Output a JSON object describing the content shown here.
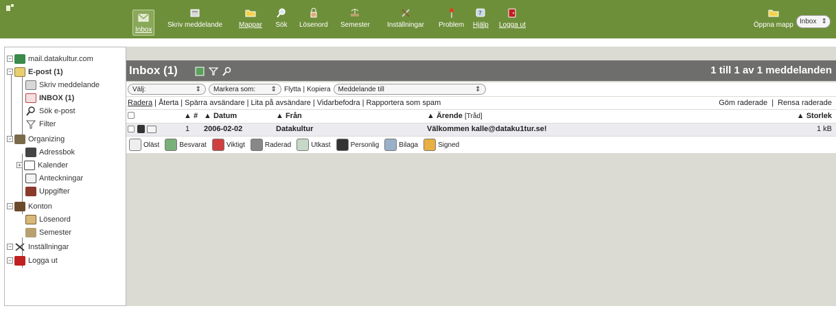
{
  "toolbar": {
    "items": [
      {
        "label": "Inbox",
        "icon": "inbox-icon",
        "color": "#dfe9c9"
      },
      {
        "label": "Skriv meddelande",
        "icon": "compose-icon",
        "color": "#d8d8d8"
      },
      {
        "label": "Mappar",
        "icon": "folder-icon",
        "color": "#f2d14c"
      },
      {
        "label": "Sök",
        "icon": "magnifier-icon",
        "color": "#d8e6f2"
      },
      {
        "label": "Lösenord",
        "icon": "lock-icon",
        "color": "#e0a97a"
      },
      {
        "label": "Semester",
        "icon": "vacation-icon",
        "color": "#b8a070"
      },
      {
        "label": "Inställningar",
        "icon": "tools-icon",
        "color": "#cfcfcf"
      },
      {
        "label": "Problem",
        "icon": "pin-icon",
        "color": "#e04020"
      },
      {
        "label": "Hjälp",
        "icon": "help-icon",
        "color": "#c8d8e8"
      },
      {
        "label": "Logga ut",
        "icon": "logout-icon",
        "color": "#c02020"
      }
    ],
    "open_folder_label": "Öppna mapp",
    "folder_select": "Inbox"
  },
  "sidebar": {
    "items": [
      {
        "label": "mail.datakultur.com",
        "icon": "server-icon"
      },
      {
        "label": "E-post (1)",
        "icon": "email-icon"
      },
      {
        "label": "Skriv meddelande",
        "icon": "compose-icon"
      },
      {
        "label": "INBOX (1)",
        "icon": "inbox-icon"
      },
      {
        "label": "Sök e-post",
        "icon": "search-icon"
      },
      {
        "label": "Filter",
        "icon": "filter-icon"
      },
      {
        "label": "Organizing",
        "icon": "organizing-icon"
      },
      {
        "label": "Adressbok",
        "icon": "addressbook-icon"
      },
      {
        "label": "Kalender",
        "icon": "calendar-icon"
      },
      {
        "label": "Anteckningar",
        "icon": "notes-icon"
      },
      {
        "label": "Uppgifter",
        "icon": "tasks-icon"
      },
      {
        "label": "Konton",
        "icon": "accounts-icon"
      },
      {
        "label": "Lösenord",
        "icon": "lock-icon"
      },
      {
        "label": "Semester",
        "icon": "vacation-icon"
      },
      {
        "label": "Inställningar",
        "icon": "tools-icon"
      },
      {
        "label": "Logga ut",
        "icon": "logout-icon"
      }
    ]
  },
  "main": {
    "title": "Inbox (1)",
    "counts": "1 till 1 av 1 meddelanden",
    "select_label": "Välj:",
    "mark_label": "Markera som:",
    "move_label": "Flytta",
    "copy_label": "Kopiera",
    "message_to_label": "Meddelande till",
    "actions": [
      "Radera",
      "Återta",
      "Spärra avsändare",
      "Lita på avsändare",
      "Vidarbefodra",
      "Rapportera som spam"
    ],
    "actions_right": [
      "Göm raderade",
      "Rensa raderade"
    ],
    "columns": {
      "num": "▲ #",
      "date": "▲ Datum",
      "from": "▲ Från",
      "subject": "▲ Ärende",
      "thread": "[Tråd]",
      "size": "▲ Storlek"
    },
    "messages": [
      {
        "num": "1",
        "date": "2006-02-02",
        "from": "Datakultur",
        "subject": "Välkommen kalle@dataku1tur.se!",
        "size": "1 kB"
      }
    ],
    "legend": [
      "Oläst",
      "Besvarat",
      "Viktigt",
      "Raderad",
      "Utkast",
      "Personlig",
      "Bilaga",
      "Signed"
    ]
  },
  "colors": {
    "toolbar_bg": "#6e8f3a",
    "header_bg": "#6e6e6c",
    "main_bg": "#dcdbd3",
    "row_bg": "#ebebf0"
  }
}
